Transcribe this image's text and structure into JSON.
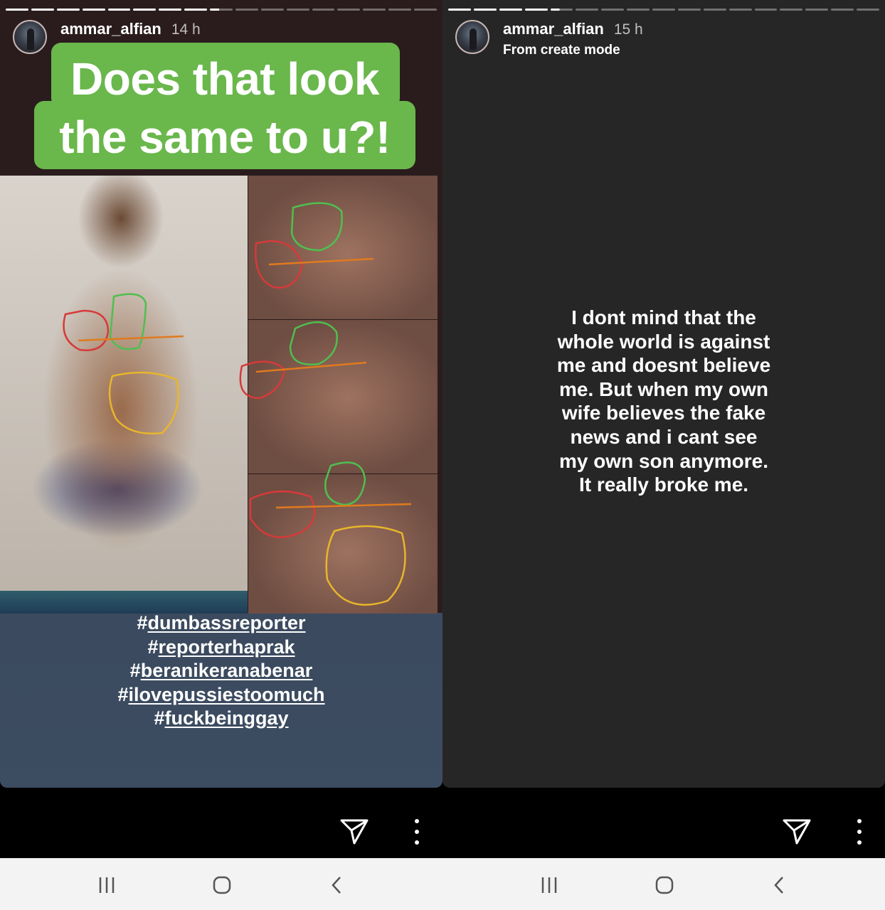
{
  "left_story": {
    "username": "ammar_alfian",
    "time": "14 h",
    "banner_line1": "Does that look",
    "banner_line2": "the same to u?!",
    "hashtags": [
      {
        "hash": "#",
        "word": "dumbassreporter"
      },
      {
        "hash": "#",
        "word": "reporterhaprak"
      },
      {
        "hash": "#",
        "word": "beranikeranabenar"
      },
      {
        "hash": "#",
        "word": "ilovepussiestoomuch"
      },
      {
        "hash": "#",
        "word": "fuckbeinggay"
      }
    ],
    "progress_done": 8,
    "progress_total": 17
  },
  "right_story": {
    "username": "ammar_alfian",
    "time": "15 h",
    "subtitle": "From create mode",
    "message_lines": [
      "I dont mind that the",
      "whole world is against",
      "me and doesnt believe",
      "me. But when my own",
      "wife believes the fake",
      "news and i cant see",
      "my own son anymore.",
      "It really broke me."
    ],
    "progress_done": 4,
    "progress_total": 17
  },
  "icons": {
    "send": "send-paper-plane-icon",
    "more": "more-vertical-icon",
    "recent": "recent-apps-icon",
    "home": "home-icon",
    "back": "back-icon"
  },
  "colors": {
    "banner_green": "#6ab74c",
    "story_dark": "#262626",
    "navbar": "#f3f3f3"
  }
}
